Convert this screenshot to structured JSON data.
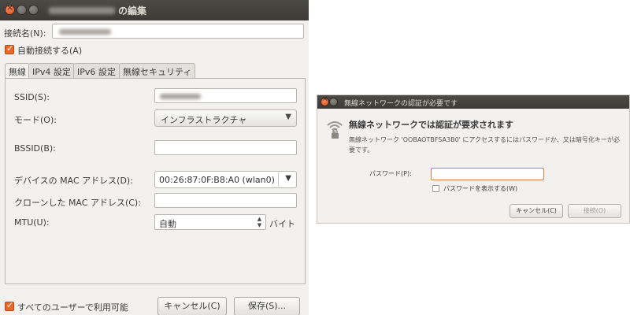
{
  "main_window": {
    "title": "の編集",
    "connection_name_label": "接続名(N):",
    "auto_connect_label": "自動接続する(A)",
    "tabs": [
      {
        "label": "無線"
      },
      {
        "label": "IPv4 設定"
      },
      {
        "label": "IPv6 設定"
      },
      {
        "label": "無線セキュリティ"
      }
    ],
    "wireless": {
      "ssid_label": "SSID(S):",
      "mode_label": "モード(O):",
      "mode_value": "インフラストラクチャ",
      "bssid_label": "BSSID(B):",
      "bssid_value": "",
      "device_mac_label": "デバイスの MAC アドレス(D):",
      "device_mac_value": "00:26:87:0F:B8:A0 (wlan0)",
      "cloned_mac_label": "クローンした MAC アドレス(C):",
      "cloned_mac_value": "",
      "mtu_label": "MTU(U):",
      "mtu_value": "自動",
      "mtu_unit": "バイト"
    },
    "all_users_label": "すべてのユーザーで利用可能",
    "cancel_label": "キャンセル(C)",
    "save_label": "保存(S)..."
  },
  "auth_dialog": {
    "title": "無線ネットワークの認証が必要です",
    "heading": "無線ネットワークでは認証が要求されます",
    "description": "無線ネットワーク 'OOBAOTBFSA3B0' にアクセスするにはパスワードか、又は暗号化キーが必要です。",
    "password_label": "パスワード(P):",
    "password_value": "",
    "show_password_label": "パスワードを表示する(W)",
    "cancel_label": "キャンセル(C)",
    "connect_label": "接続(O)"
  },
  "colors": {
    "titlebar": "#3c3b37",
    "window_bg": "#f2f1f0",
    "accent_orange": "#e86a2b"
  }
}
